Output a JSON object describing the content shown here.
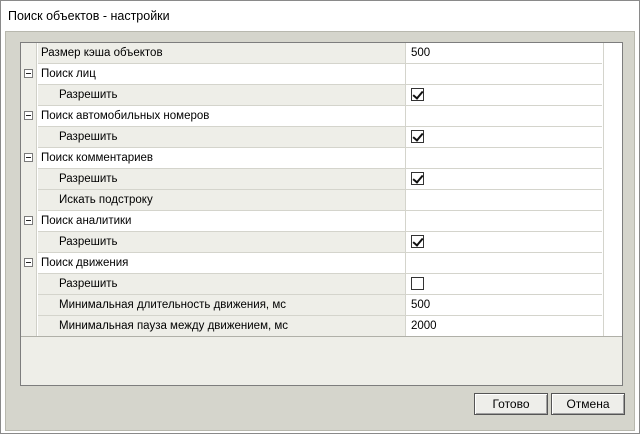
{
  "window": {
    "title": "Поиск объектов - настройки"
  },
  "rows": [
    {
      "kind": "prop",
      "name": "Размер кэша объектов",
      "value": "500"
    },
    {
      "kind": "cat",
      "name": "Поиск лиц"
    },
    {
      "kind": "sub",
      "name": "Разрешить",
      "checked": true
    },
    {
      "kind": "cat",
      "name": "Поиск автомобильных номеров"
    },
    {
      "kind": "sub",
      "name": "Разрешить",
      "checked": true
    },
    {
      "kind": "cat",
      "name": "Поиск комментариев"
    },
    {
      "kind": "sub",
      "name": "Разрешить",
      "checked": true
    },
    {
      "kind": "sub",
      "name": "Искать подстроку",
      "value": ""
    },
    {
      "kind": "cat",
      "name": "Поиск аналитики"
    },
    {
      "kind": "sub",
      "name": "Разрешить",
      "checked": true
    },
    {
      "kind": "cat",
      "name": "Поиск движения"
    },
    {
      "kind": "sub",
      "name": "Разрешить",
      "checked": false
    },
    {
      "kind": "sub",
      "name": "Минимальная длительность движения, мс",
      "value": "500"
    },
    {
      "kind": "sub",
      "name": "Минимальная пауза между движением, мс",
      "value": "2000"
    }
  ],
  "buttons": {
    "ok_label": "Готово",
    "cancel_label": "Отмена"
  }
}
